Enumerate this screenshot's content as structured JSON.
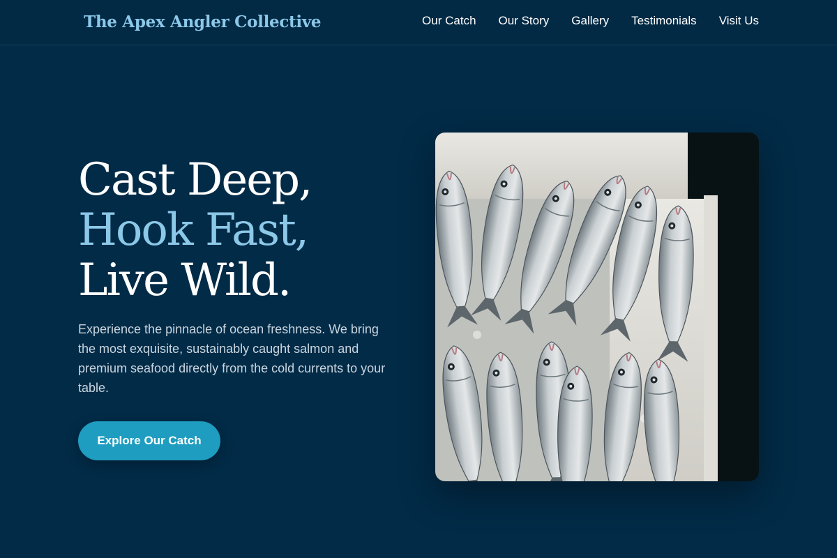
{
  "brand": {
    "name": "The Apex Angler Collective"
  },
  "nav": {
    "items": [
      {
        "label": "Our Catch"
      },
      {
        "label": "Our Story"
      },
      {
        "label": "Gallery"
      },
      {
        "label": "Testimonials"
      },
      {
        "label": "Visit Us"
      }
    ]
  },
  "hero": {
    "headline_line1": "Cast Deep,",
    "headline_line2": "Hook Fast,",
    "headline_line3": "Live Wild.",
    "description": "Experience the pinnacle of ocean freshness. We bring the most exquisite, sustainably caught salmon and premium seafood directly from the cold currents to your table.",
    "cta_label": "Explore Our Catch",
    "image_subject": "fresh fish on ice in a white crate"
  },
  "colors": {
    "background": "#022b47",
    "accent": "#8cc8e8",
    "button": "#1e9dc0",
    "text": "#ffffff"
  }
}
